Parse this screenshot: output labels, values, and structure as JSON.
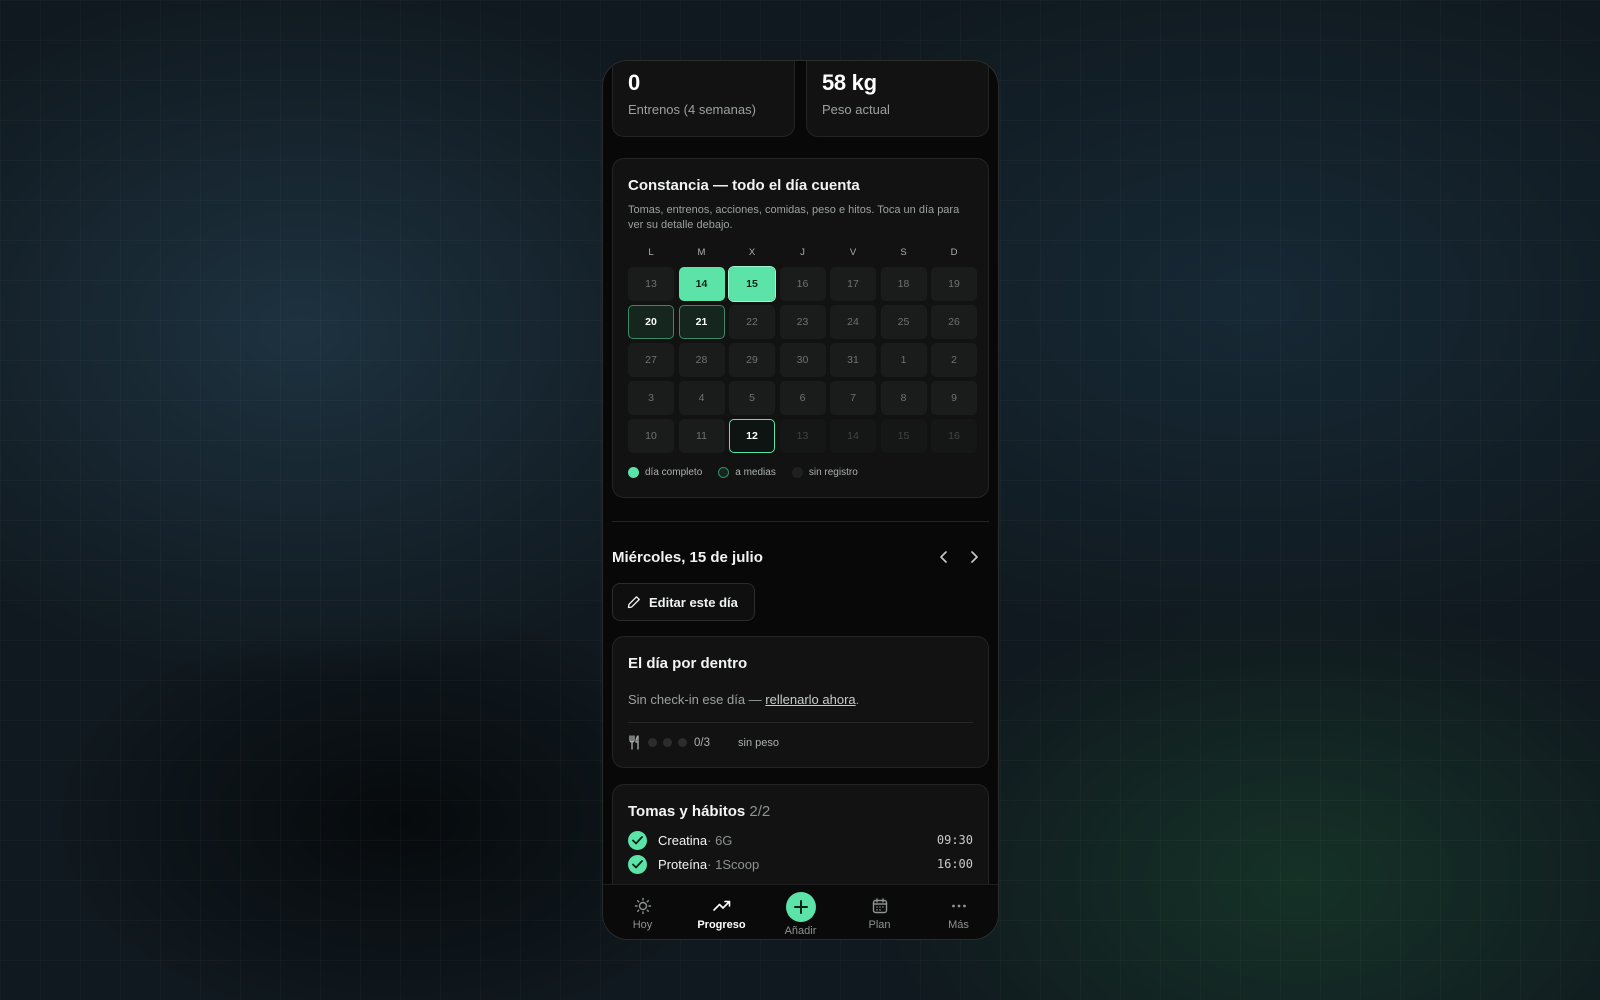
{
  "stats": [
    {
      "value": "0",
      "label": "Entrenos (4 semanas)"
    },
    {
      "value": "58 kg",
      "label": "Peso actual"
    }
  ],
  "consistency": {
    "title": "Constancia — todo el día cuenta",
    "subtitle": "Tomas, entrenos, acciones, comidas, peso e hitos. Toca un día para ver su detalle debajo.",
    "weekdays": [
      "L",
      "M",
      "X",
      "J",
      "V",
      "S",
      "D"
    ],
    "weeks": [
      [
        {
          "d": "13",
          "s": "empty"
        },
        {
          "d": "14",
          "s": "full"
        },
        {
          "d": "15",
          "s": "full-selected"
        },
        {
          "d": "16",
          "s": "empty"
        },
        {
          "d": "17",
          "s": "empty"
        },
        {
          "d": "18",
          "s": "empty"
        },
        {
          "d": "19",
          "s": "empty"
        }
      ],
      [
        {
          "d": "20",
          "s": "half"
        },
        {
          "d": "21",
          "s": "half"
        },
        {
          "d": "22",
          "s": "empty"
        },
        {
          "d": "23",
          "s": "empty"
        },
        {
          "d": "24",
          "s": "empty"
        },
        {
          "d": "25",
          "s": "empty"
        },
        {
          "d": "26",
          "s": "empty"
        }
      ],
      [
        {
          "d": "27",
          "s": "empty"
        },
        {
          "d": "28",
          "s": "empty"
        },
        {
          "d": "29",
          "s": "empty"
        },
        {
          "d": "30",
          "s": "empty"
        },
        {
          "d": "31",
          "s": "empty"
        },
        {
          "d": "1",
          "s": "empty"
        },
        {
          "d": "2",
          "s": "empty"
        }
      ],
      [
        {
          "d": "3",
          "s": "empty"
        },
        {
          "d": "4",
          "s": "empty"
        },
        {
          "d": "5",
          "s": "empty"
        },
        {
          "d": "6",
          "s": "empty"
        },
        {
          "d": "7",
          "s": "empty"
        },
        {
          "d": "8",
          "s": "empty"
        },
        {
          "d": "9",
          "s": "empty"
        }
      ],
      [
        {
          "d": "10",
          "s": "empty"
        },
        {
          "d": "11",
          "s": "empty"
        },
        {
          "d": "12",
          "s": "today"
        },
        {
          "d": "13",
          "s": "future"
        },
        {
          "d": "14",
          "s": "future"
        },
        {
          "d": "15",
          "s": "future"
        },
        {
          "d": "16",
          "s": "future"
        }
      ]
    ],
    "legend": {
      "full": "día completo",
      "half": "a medias",
      "none": "sin registro"
    }
  },
  "day_detail": {
    "title": "Miércoles, 15 de julio",
    "edit_label": "Editar este día"
  },
  "inside": {
    "title": "El día por dentro",
    "text": "Sin check-in ese día — ",
    "link": "rellenarlo ahora",
    "suffix": ".",
    "meals_count": "0/3",
    "weight_status": "sin peso"
  },
  "habits": {
    "title": "Tomas y hábitos",
    "count": "2/2",
    "items": [
      {
        "name": "Creatina",
        "dose": " · 6G",
        "time": "09:30"
      },
      {
        "name": "Proteína",
        "dose": " · 1Scoop",
        "time": "16:00"
      }
    ]
  },
  "tabbar": {
    "hoy": "Hoy",
    "progreso": "Progreso",
    "anadir": "Añadir",
    "plan": "Plan",
    "mas": "Más"
  },
  "colors": {
    "accent": "#5be3a8",
    "background": "#080808",
    "card": "#121212"
  },
  "icons": [
    "pencil-icon",
    "chevron-left-icon",
    "chevron-right-icon",
    "fork-knife-icon",
    "check-icon",
    "sun-icon",
    "trending-up-icon",
    "plus-icon",
    "calendar-icon",
    "more-icon"
  ]
}
